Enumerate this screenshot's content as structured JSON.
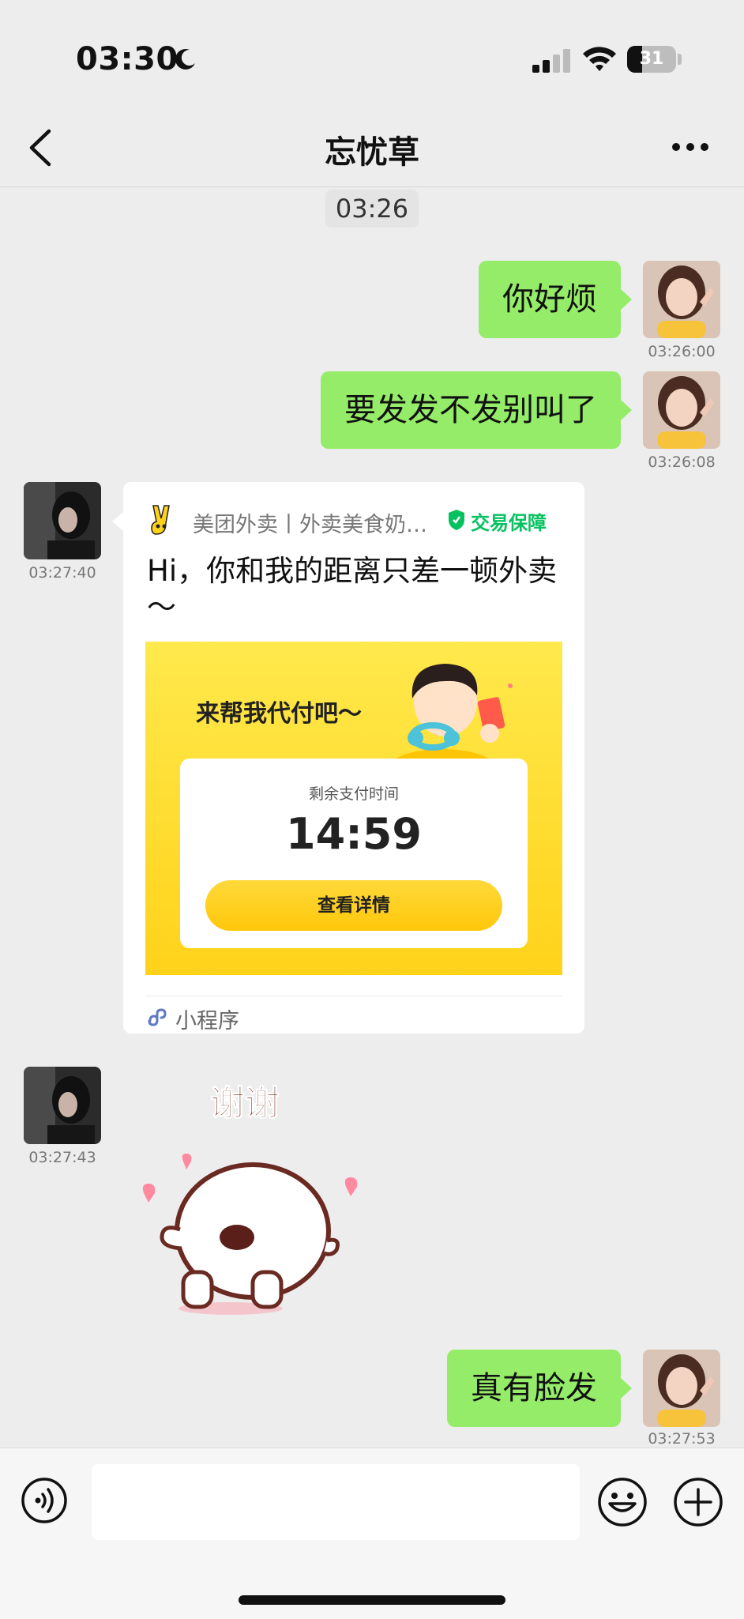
{
  "status_bar": {
    "time": "03:30",
    "battery": "31",
    "battery_level": 0.31
  },
  "nav": {
    "title": "忘忧草"
  },
  "timestamp": "03:26",
  "messages": [
    {
      "side": "right",
      "text": "你好烦",
      "time": "03:26:00"
    },
    {
      "side": "right",
      "text": "要发发不发别叫了",
      "time": "03:26:08"
    },
    {
      "side": "left",
      "type": "mini_program_card",
      "time": "03:27:40",
      "card": {
        "app_name": "美团外卖丨外卖美食奶…",
        "badge": "交易保障",
        "title": "Hi，你和我的距离只差一顿外卖～",
        "promo_text": "来帮我代付吧～",
        "pay_label": "剩余支付时间",
        "pay_time": "14:59",
        "button": "查看详情",
        "footer": "小程序"
      }
    },
    {
      "side": "left",
      "type": "sticker",
      "time": "03:27:43",
      "sticker_text": "谢谢"
    },
    {
      "side": "right",
      "text": "真有脸发",
      "time": "03:27:53"
    }
  ],
  "input_bar": {
    "placeholder": ""
  },
  "colors": {
    "bubble_green": "#95ec69",
    "background": "#ededed",
    "badge_green": "#07c160",
    "promo_yellow": "#ffd21a"
  }
}
